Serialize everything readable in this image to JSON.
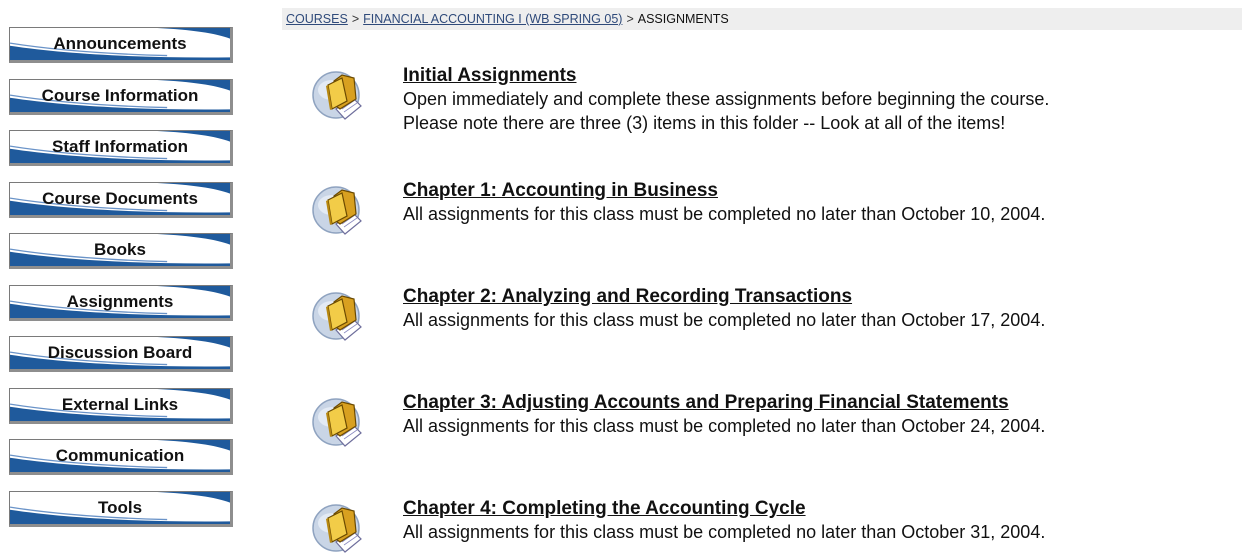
{
  "sidebar": {
    "items": [
      {
        "label": "Announcements"
      },
      {
        "label": "Course Information"
      },
      {
        "label": "Staff Information"
      },
      {
        "label": "Course Documents"
      },
      {
        "label": "Books"
      },
      {
        "label": "Assignments"
      },
      {
        "label": "Discussion Board"
      },
      {
        "label": "External Links"
      },
      {
        "label": "Communication"
      },
      {
        "label": "Tools"
      }
    ]
  },
  "breadcrumb": {
    "courses": "COURSES",
    "course": "FINANCIAL ACCOUNTING I (WB SPRING 05)",
    "current": "ASSIGNMENTS",
    "separator": ">"
  },
  "items": [
    {
      "title": "Initial Assignments",
      "desc_lines": [
        "Open immediately and complete these assignments before beginning the course.",
        "Please note there are three (3) items in this folder -- Look at all of the items!"
      ],
      "icon": "folder-icon"
    },
    {
      "title": "Chapter 1: Accounting in Business",
      "desc_lines": [
        "All assignments for this class must be completed no later than October 10, 2004."
      ],
      "icon": "folder-icon"
    },
    {
      "title": "Chapter 2: Analyzing and Recording Transactions",
      "desc_lines": [
        "All assignments for this class must be completed no later than October 17, 2004."
      ],
      "icon": "folder-icon"
    },
    {
      "title": "Chapter 3: Adjusting Accounts and Preparing Financial Statements",
      "desc_lines": [
        "All assignments for this class must be completed no later than October 24, 2004."
      ],
      "icon": "folder-icon"
    },
    {
      "title": "Chapter 4: Completing the Accounting Cycle",
      "desc_lines": [
        "All assignments for this class must be completed no later than October 31, 2004."
      ],
      "icon": "folder-icon"
    }
  ],
  "colors": {
    "nav_swoosh": "#1f5a9c",
    "breadcrumb_bg": "#eeeeee",
    "link": "#2f4a7a"
  }
}
